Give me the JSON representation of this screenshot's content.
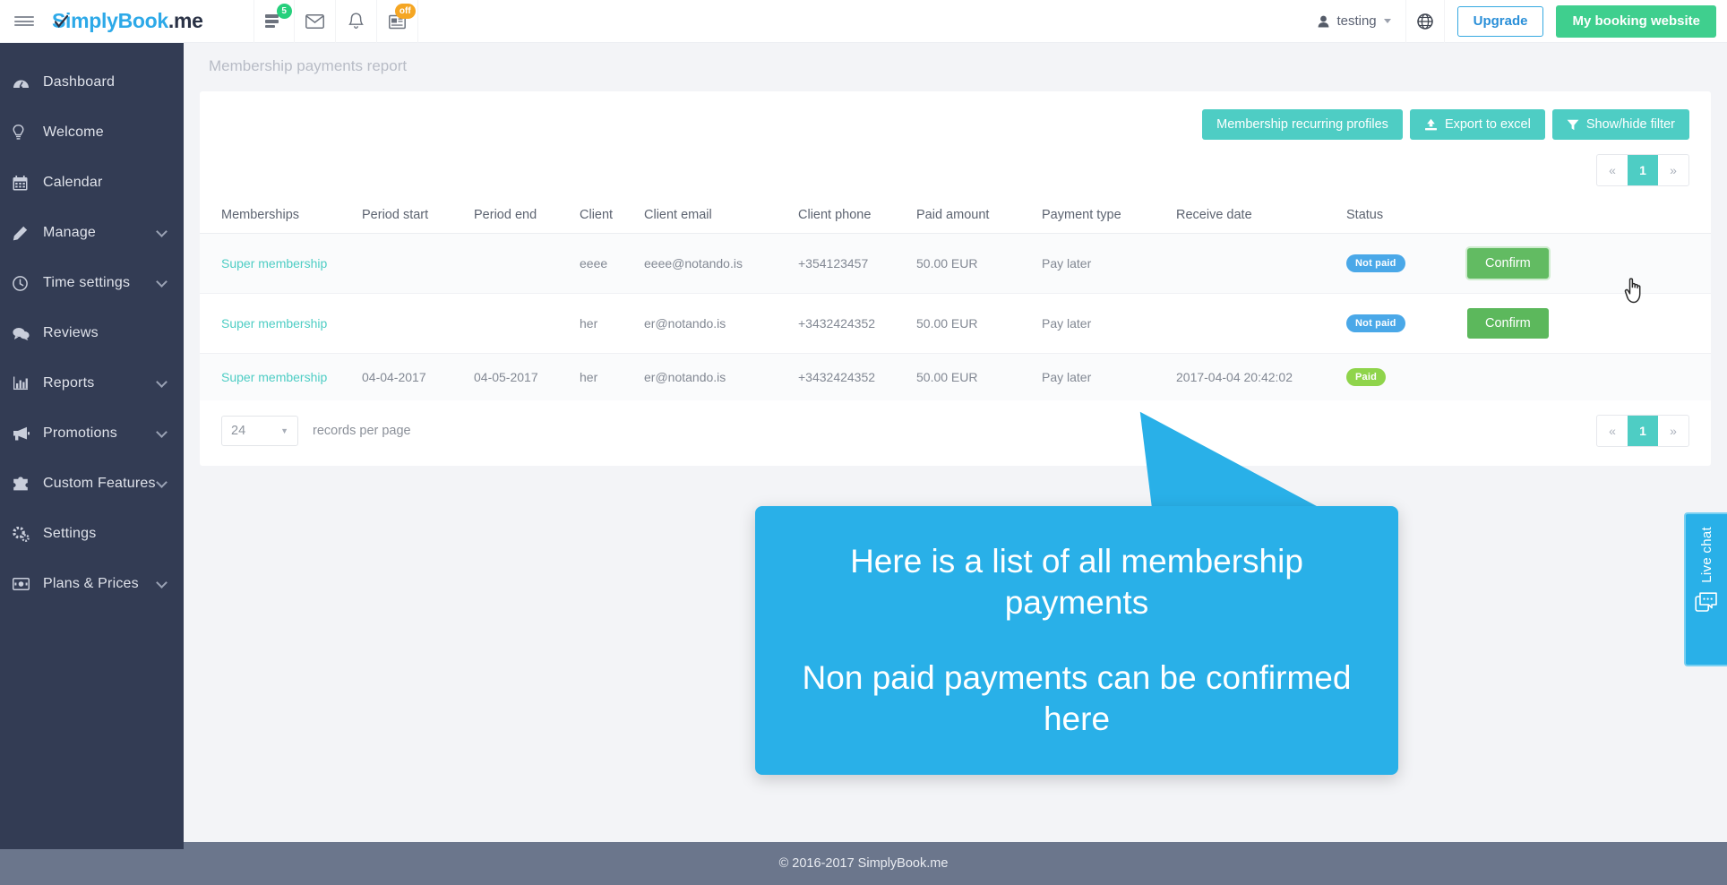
{
  "header": {
    "brand_primary": "S",
    "brand_main": "implyBook",
    "brand_suffix": ".me",
    "icons": [
      {
        "name": "server-icon",
        "badge": "5",
        "badge_color": "#26d07c"
      },
      {
        "name": "envelope-icon",
        "badge": "",
        "badge_color": ""
      },
      {
        "name": "bell-icon",
        "badge": "",
        "badge_color": ""
      },
      {
        "name": "news-icon",
        "badge": "off",
        "badge_color": "#f5a623"
      }
    ],
    "user_name": "testing",
    "upgrade_label": "Upgrade",
    "booking_website_label": "My booking website"
  },
  "sidebar": {
    "items": [
      {
        "label": "Dashboard",
        "icon": "dashboard-icon",
        "expandable": false
      },
      {
        "label": "Welcome",
        "icon": "bulb-icon",
        "expandable": false
      },
      {
        "label": "Calendar",
        "icon": "calendar-icon",
        "expandable": false
      },
      {
        "label": "Manage",
        "icon": "pencil-icon",
        "expandable": true
      },
      {
        "label": "Time settings",
        "icon": "clock-icon",
        "expandable": true
      },
      {
        "label": "Reviews",
        "icon": "comments-icon",
        "expandable": false
      },
      {
        "label": "Reports",
        "icon": "bar-chart-icon",
        "expandable": true
      },
      {
        "label": "Promotions",
        "icon": "megaphone-icon",
        "expandable": true
      },
      {
        "label": "Custom Features",
        "icon": "puzzle-icon",
        "expandable": true
      },
      {
        "label": "Settings",
        "icon": "gears-icon",
        "expandable": false
      },
      {
        "label": "Plans & Prices",
        "icon": "money-icon",
        "expandable": true
      }
    ]
  },
  "main": {
    "breadcrumb": "Membership payments report",
    "toolbar": {
      "recurring_profiles_label": "Membership recurring profiles",
      "export_excel_label": "Export to excel",
      "show_hide_filter_label": "Show/hide filter"
    },
    "pagination": {
      "prev": "«",
      "pages": [
        "1"
      ],
      "next": "»",
      "active": "1"
    },
    "table": {
      "columns": [
        "Memberships",
        "Period start",
        "Period end",
        "Client",
        "Client email",
        "Client phone",
        "Paid amount",
        "Payment type",
        "Receive date",
        "Status",
        ""
      ],
      "rows": [
        {
          "membership": "Super membership",
          "period_start": "",
          "period_end": "",
          "client": "eeee",
          "client_email": "eeee@notando.is",
          "client_phone": "+354123457",
          "paid_amount": "50.00 EUR",
          "payment_type": "Pay later",
          "receive_date": "",
          "status": "Not paid",
          "status_kind": "notpaid",
          "action": "Confirm",
          "action_hover": true
        },
        {
          "membership": "Super membership",
          "period_start": "",
          "period_end": "",
          "client": "her",
          "client_email": "er@notando.is",
          "client_phone": "+3432424352",
          "paid_amount": "50.00 EUR",
          "payment_type": "Pay later",
          "receive_date": "",
          "status": "Not paid",
          "status_kind": "notpaid",
          "action": "Confirm",
          "action_hover": false
        },
        {
          "membership": "Super membership",
          "period_start": "04-04-2017",
          "period_end": "04-05-2017",
          "client": "her",
          "client_email": "er@notando.is",
          "client_phone": "+3432424352",
          "paid_amount": "50.00 EUR",
          "payment_type": "Pay later",
          "receive_date": "2017-04-04 20:42:02",
          "status": "Paid",
          "status_kind": "paid",
          "action": "",
          "action_hover": false
        }
      ]
    },
    "records_per_page": {
      "value": "24",
      "label": "records per page"
    }
  },
  "callout": {
    "line1": "Here is a list of all membership payments",
    "line2": "Non paid payments can be confirmed here",
    "color": "#29b0e8"
  },
  "live_chat": {
    "label": "Live chat",
    "color": "#29b0e8"
  },
  "footer": {
    "copyright": "© 2016-2017 SimplyBook.me"
  },
  "colors": {
    "sidebar_bg": "#333c54",
    "teal": "#4ecdc4",
    "green": "#3fcf8e",
    "confirm_green": "#5cb85c",
    "footer_bg": "#6b768c"
  }
}
